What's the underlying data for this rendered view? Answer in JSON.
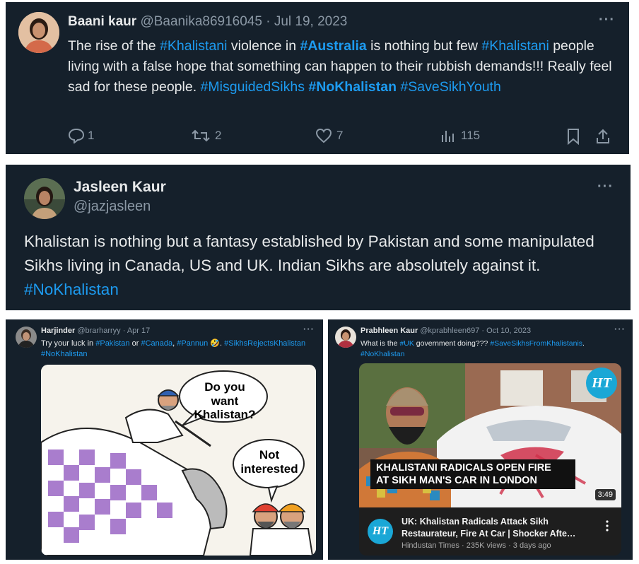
{
  "tweet1": {
    "name": "Baani kaur",
    "handle": "@Baanika86916045",
    "sep": "·",
    "date": "Jul 19, 2023",
    "text": {
      "t1": "The rise of the ",
      "h1": "#Khalistani",
      "t2": " violence in ",
      "h2": "#Australia",
      "t3": " is nothing but few ",
      "h3": "#Khalistani",
      "t4": " people living with a false hope that something can happen to their rubbish demands!!! Really feel sad for these people. ",
      "h4": "#MisguidedSikhs",
      "t5": " ",
      "h5": "#NoKhalistan",
      "t6": " ",
      "h6": "#SaveSikhYouth"
    },
    "actions": {
      "replies": "1",
      "reposts": "2",
      "likes": "7",
      "views": "115"
    },
    "more": "···"
  },
  "tweet2": {
    "name": "Jasleen Kaur",
    "handle": "@jazjasleen",
    "text": {
      "t1": "Khalistan is nothing but a fantasy established by Pakistan and some manipulated Sikhs living in Canada, US and UK. Indian Sikhs are absolutely against it.  ",
      "h1": "#NoKhalistan"
    },
    "more": "···"
  },
  "tweet3": {
    "name": "Harjinder",
    "handle": "@brarharryy",
    "sep": "·",
    "date": "Apr 17",
    "text": {
      "t1": "Try your luck in ",
      "h1": "#Pakistan",
      "t2": " or ",
      "h2": "#Canada",
      "t3": ", ",
      "h3": "#Pannun",
      "emoji": " 🤣. ",
      "h4": "#SikhsRejectsKhalistan",
      "t4": " ",
      "h5": "#NoKhalistan"
    },
    "cartoon": {
      "bubble1": "Do you want Khalistan?",
      "bubble2": "Not interested"
    },
    "more": "···"
  },
  "tweet4": {
    "name": "Prabhleen Kaur",
    "handle": "@kprabhleen697",
    "sep": "·",
    "date": "Oct 10, 2023",
    "text": {
      "t1": "What is the ",
      "h1": "#UK",
      "t2": " government doing??? ",
      "h2": "#SaveSikhsFromKhalistanis",
      "t3": ". ",
      "h3": "#NoKhalistan"
    },
    "video": {
      "logo": "HT",
      "headline_line1": "KHALISTANI RADICALS OPEN FIRE",
      "headline_line2": "AT SIKH MAN'S CAR IN LONDON",
      "duration": "3:49",
      "title": "UK: Khalistan Radicals Attack Sikh Restaurateur, Fire At Car | Shocker Afte…",
      "channel": "Hindustan Times",
      "views": "235K views",
      "age": "3 days ago",
      "dot": "·"
    },
    "more": "···"
  },
  "colors": {
    "bg": "#15202b",
    "text": "#e7e9ea",
    "link": "#1d9bf0",
    "muted": "#8b98a5"
  }
}
